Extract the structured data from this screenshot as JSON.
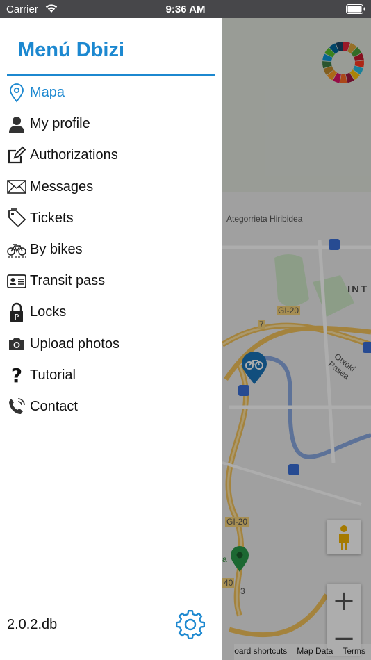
{
  "status_bar": {
    "carrier": "Carrier",
    "time": "9:36 AM"
  },
  "drawer": {
    "title": "Menú Dbizi",
    "items": [
      {
        "label": "Mapa",
        "icon": "location-pin-icon",
        "active": true
      },
      {
        "label": "My profile",
        "icon": "user-icon"
      },
      {
        "label": "Authorizations",
        "icon": "edit-icon"
      },
      {
        "label": "Messages",
        "icon": "envelope-icon"
      },
      {
        "label": "Tickets",
        "icon": "tag-icon"
      },
      {
        "label": "By bikes",
        "icon": "bike-icon"
      },
      {
        "label": "Transit pass",
        "icon": "id-card-icon"
      },
      {
        "label": "Locks",
        "icon": "lock-icon"
      },
      {
        "label": "Upload photos",
        "icon": "camera-icon"
      },
      {
        "label": "Tutorial",
        "icon": "question-icon"
      },
      {
        "label": "Contact",
        "icon": "phone-icon"
      }
    ],
    "version": "2.0.2.db",
    "accent_color": "#1c88d0"
  },
  "map": {
    "labels": {
      "street_ategorrieta": "Ategorrieta Hiribidea",
      "district_int": "INT",
      "road_gi20_a": "GI-20",
      "road_gi20_b": "GI-20",
      "road_7": "7",
      "street_otxoki": "Otxoki Pasea",
      "road_40": "40",
      "road_3": "3",
      "place_a": "a"
    },
    "zoom_in": "+",
    "zoom_out": "−",
    "attribution": {
      "shortcuts": "oard shortcuts",
      "data": "Map Data",
      "terms": "Terms"
    }
  }
}
